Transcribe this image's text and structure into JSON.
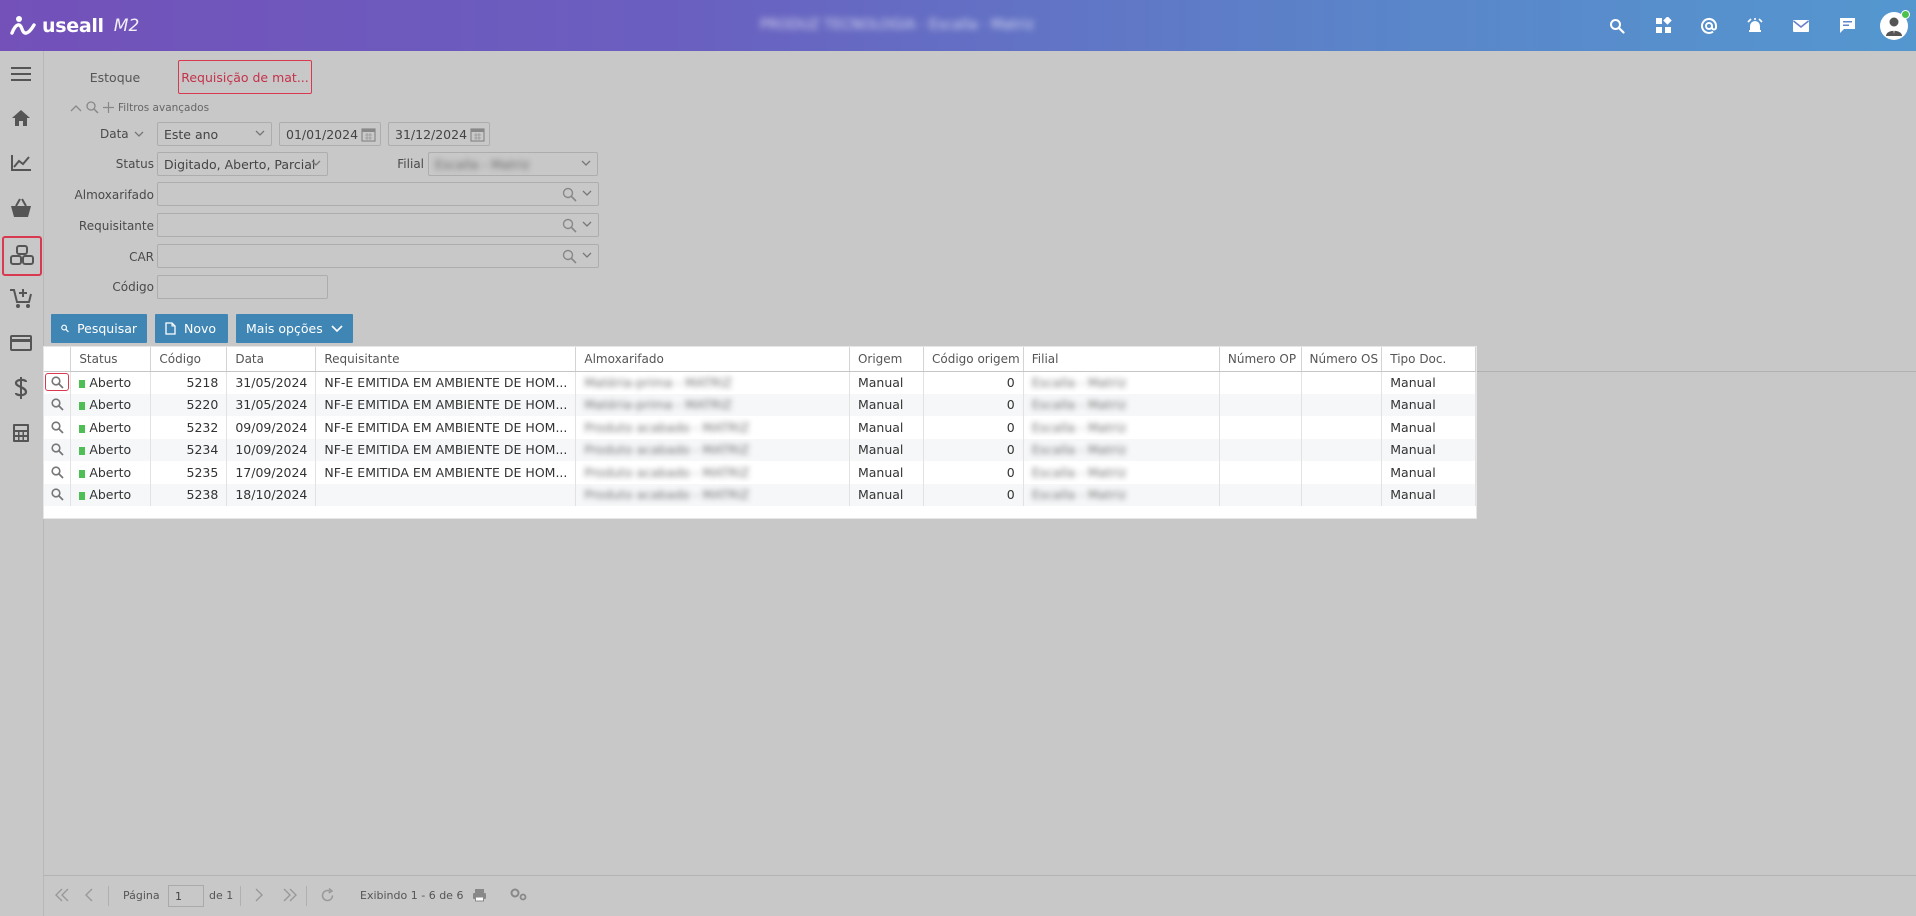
{
  "header": {
    "brand_name": "useall",
    "brand_version": "M2",
    "context_text": "PRODUZ TECNOLOGIA · Escalla · Matriz",
    "icons": [
      "search-icon",
      "widgets-icon",
      "at-icon",
      "alarm-icon",
      "mail-icon",
      "chat-icon",
      "user-avatar-icon"
    ]
  },
  "sidebar": {
    "items": [
      "menu-icon",
      "home-icon",
      "chart-icon",
      "basket-icon",
      "boxes-icon",
      "cart-add-icon",
      "card-icon",
      "dollar-icon",
      "calculator-icon"
    ],
    "active": "boxes-icon"
  },
  "tabs": [
    {
      "label": "Estoque",
      "active": false
    },
    {
      "label": "Requisição de mat...",
      "active": true
    }
  ],
  "filters": {
    "toggle_label": "Filtros avançados",
    "date_label": "Data",
    "date_period": "Este ano",
    "date_from": "01/01/2024",
    "date_to": "31/12/2024",
    "status_label": "Status",
    "status_value": "Digitado, Aberto, Parcial",
    "filial_label": "Filial",
    "filial_value": "Escalla - Matriz",
    "almoxarifado_label": "Almoxarifado",
    "almoxarifado_value": "",
    "requisitante_label": "Requisitante",
    "requisitante_value": "",
    "car_label": "CAR",
    "car_value": "",
    "codigo_label": "Código",
    "codigo_value": ""
  },
  "buttons": {
    "search": "Pesquisar",
    "new": "Novo",
    "more": "Mais opções"
  },
  "grid": {
    "columns": [
      "Status",
      "Código",
      "Data",
      "Requisitante",
      "Almoxarifado",
      "Origem",
      "Código origem",
      "Filial",
      "Número OP",
      "Número OS",
      "Tipo Doc."
    ],
    "rows": [
      {
        "status": "Aberto",
        "codigo": "5218",
        "data": "31/05/2024",
        "requisitante": "NF-E EMITIDA EM AMBIENTE DE HOM...",
        "almoxarifado": "Matéria-prima - MATRIZ",
        "origem": "Manual",
        "codigo_origem": "0",
        "filial": "Escalla - Matriz",
        "numero_op": "",
        "numero_os": "",
        "tipo_doc": "Manual"
      },
      {
        "status": "Aberto",
        "codigo": "5220",
        "data": "31/05/2024",
        "requisitante": "NF-E EMITIDA EM AMBIENTE DE HOM...",
        "almoxarifado": "Matéria-prima - MATRIZ",
        "origem": "Manual",
        "codigo_origem": "0",
        "filial": "Escalla - Matriz",
        "numero_op": "",
        "numero_os": "",
        "tipo_doc": "Manual"
      },
      {
        "status": "Aberto",
        "codigo": "5232",
        "data": "09/09/2024",
        "requisitante": "NF-E EMITIDA EM AMBIENTE DE HOM...",
        "almoxarifado": "Produto acabado - MATRIZ",
        "origem": "Manual",
        "codigo_origem": "0",
        "filial": "Escalla - Matriz",
        "numero_op": "",
        "numero_os": "",
        "tipo_doc": "Manual"
      },
      {
        "status": "Aberto",
        "codigo": "5234",
        "data": "10/09/2024",
        "requisitante": "NF-E EMITIDA EM AMBIENTE DE HOM...",
        "almoxarifado": "Produto acabado - MATRIZ",
        "origem": "Manual",
        "codigo_origem": "0",
        "filial": "Escalla - Matriz",
        "numero_op": "",
        "numero_os": "",
        "tipo_doc": "Manual"
      },
      {
        "status": "Aberto",
        "codigo": "5235",
        "data": "17/09/2024",
        "requisitante": "NF-E EMITIDA EM AMBIENTE DE HOM...",
        "almoxarifado": "Produto acabado - MATRIZ",
        "origem": "Manual",
        "codigo_origem": "0",
        "filial": "Escalla - Matriz",
        "numero_op": "",
        "numero_os": "",
        "tipo_doc": "Manual"
      },
      {
        "status": "Aberto",
        "codigo": "5238",
        "data": "18/10/2024",
        "requisitante": "",
        "almoxarifado": "Produto acabado - MATRIZ",
        "origem": "Manual",
        "codigo_origem": "0",
        "filial": "Escalla - Matriz",
        "numero_op": "",
        "numero_os": "",
        "tipo_doc": "Manual"
      }
    ]
  },
  "footer": {
    "page_label": "Página",
    "page_value": "1",
    "of_label": "de 1",
    "display_text": "Exibindo 1 - 6 de 6"
  },
  "colors": {
    "header_gradient_start": "#7351b9",
    "header_gradient_end": "#5497cf",
    "button": "#3f86b5",
    "highlight": "#d9394f",
    "status_open": "#4fbf55",
    "background": "#c8c8c8"
  }
}
